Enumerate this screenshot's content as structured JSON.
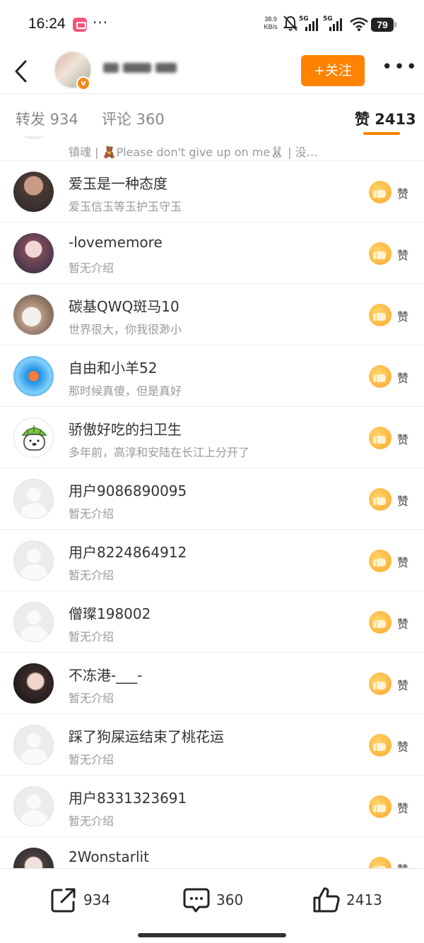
{
  "status_bar": {
    "time": "16:24",
    "net_speed_value": "38.9",
    "net_speed_unit": "KB/s",
    "signal1_label": "5G",
    "signal2_label": "5G",
    "battery": "79"
  },
  "header": {
    "follow_label": "+关注",
    "more_label": "•••"
  },
  "tabs": {
    "repost": "转发 934",
    "comment": "评论 360",
    "like": "赞 2413"
  },
  "likers": [
    {
      "name": "",
      "desc": "镇魂 | 🧸Please don't give up on me🐰 | 没…",
      "like_label": ""
    },
    {
      "name": "爱玉是一种态度",
      "desc": "爱玉信玉等玉护玉守玉",
      "like_label": "赞"
    },
    {
      "name": "-lovememore",
      "desc": "暂无介绍",
      "like_label": "赞"
    },
    {
      "name": "碳基QWQ斑马10",
      "desc": "世界很大，你我很渺小",
      "like_label": "赞"
    },
    {
      "name": "自由和小羊52",
      "desc": "那时候真傻，但是真好",
      "like_label": "赞"
    },
    {
      "name": "骄傲好吃的扫卫生",
      "desc": "多年前，高淳和安陆在长江上分开了",
      "like_label": "赞"
    },
    {
      "name": "用户9086890095",
      "desc": "暂无介绍",
      "like_label": "赞"
    },
    {
      "name": "用户8224864912",
      "desc": "暂无介绍",
      "like_label": "赞"
    },
    {
      "name": "僧璨198002",
      "desc": "暂无介绍",
      "like_label": "赞"
    },
    {
      "name": "不冻港-___-",
      "desc": "暂无介绍",
      "like_label": "赞"
    },
    {
      "name": "踩了狗屎运结束了桃花运",
      "desc": "暂无介绍",
      "like_label": "赞"
    },
    {
      "name": "用户8331323691",
      "desc": "暂无介绍",
      "like_label": "赞"
    },
    {
      "name": "2Wonstarlit",
      "desc": "",
      "like_label": "赞"
    }
  ],
  "bottom_bar": {
    "repost_count": "934",
    "comment_count": "360",
    "like_count": "2413"
  },
  "colors": {
    "accent": "#ff8200",
    "like_badge": "#ffb53d",
    "text_primary": "#333333",
    "text_secondary": "#999999"
  }
}
